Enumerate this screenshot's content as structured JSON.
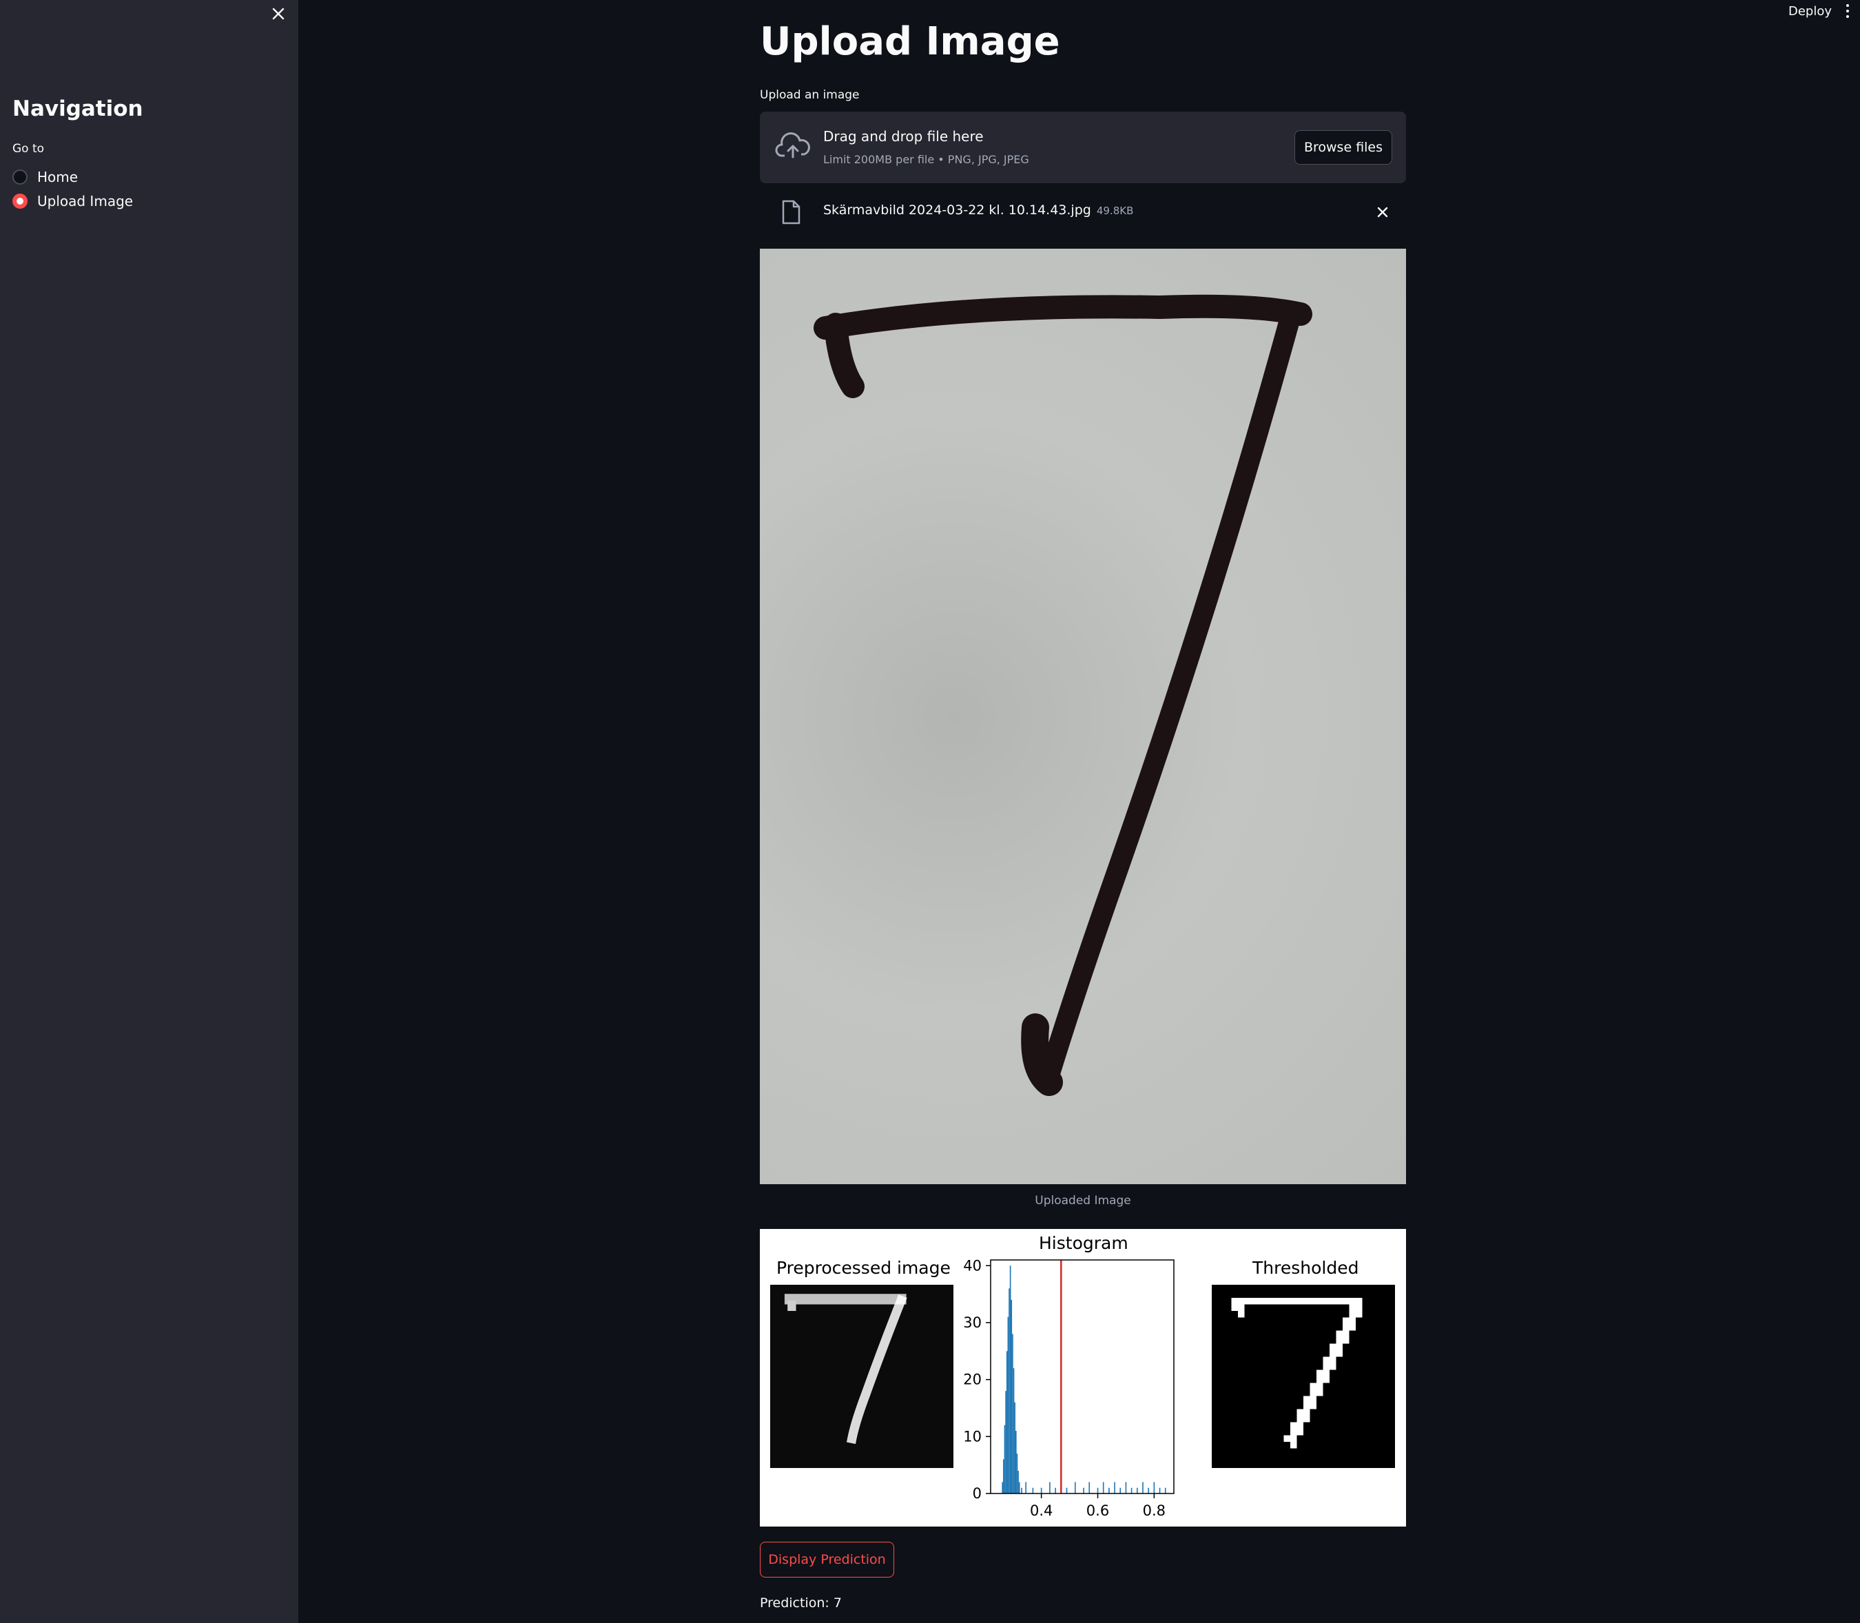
{
  "sidebar": {
    "title": "Navigation",
    "radio_label": "Go to",
    "options": [
      {
        "label": "Home",
        "selected": false
      },
      {
        "label": "Upload Image",
        "selected": true
      }
    ]
  },
  "header": {
    "deploy_label": "Deploy"
  },
  "main": {
    "title": "Upload Image",
    "uploader": {
      "label": "Upload an image",
      "drop_text": "Drag and drop file here",
      "limit_text": "Limit 200MB per file • PNG, JPG, JPEG",
      "browse_label": "Browse files"
    },
    "file": {
      "name": "Skärmavbild 2024-03-22 kl. 10.14.43.jpg",
      "size": "49.8KB"
    },
    "image_caption": "Uploaded Image",
    "figure": {
      "titles": {
        "preprocessed": "Preprocessed image",
        "histogram": "Histogram",
        "thresholded": "Thresholded"
      },
      "colors": {
        "bars": "#1f77b4",
        "threshold": "#d62728"
      }
    },
    "predict_button": "Display Prediction",
    "prediction_text": "Prediction: 7"
  },
  "chart_data": {
    "type": "bar",
    "title": "Histogram",
    "xlabel": "",
    "ylabel": "",
    "xlim": [
      0.22,
      0.87
    ],
    "ylim": [
      0,
      41
    ],
    "x_ticks": [
      0.4,
      0.6,
      0.8
    ],
    "y_ticks": [
      0,
      10,
      20,
      30,
      40
    ],
    "threshold_line_x": 0.47,
    "bins": [
      {
        "x": 0.262,
        "y": 2
      },
      {
        "x": 0.266,
        "y": 6
      },
      {
        "x": 0.27,
        "y": 12
      },
      {
        "x": 0.274,
        "y": 18
      },
      {
        "x": 0.278,
        "y": 25
      },
      {
        "x": 0.282,
        "y": 31
      },
      {
        "x": 0.286,
        "y": 36
      },
      {
        "x": 0.29,
        "y": 40
      },
      {
        "x": 0.294,
        "y": 34
      },
      {
        "x": 0.298,
        "y": 28
      },
      {
        "x": 0.302,
        "y": 22
      },
      {
        "x": 0.306,
        "y": 16
      },
      {
        "x": 0.31,
        "y": 11
      },
      {
        "x": 0.314,
        "y": 7
      },
      {
        "x": 0.318,
        "y": 4
      },
      {
        "x": 0.322,
        "y": 2
      },
      {
        "x": 0.33,
        "y": 1
      },
      {
        "x": 0.345,
        "y": 2
      },
      {
        "x": 0.37,
        "y": 1
      },
      {
        "x": 0.4,
        "y": 1
      },
      {
        "x": 0.43,
        "y": 2
      },
      {
        "x": 0.45,
        "y": 1
      },
      {
        "x": 0.49,
        "y": 1
      },
      {
        "x": 0.52,
        "y": 2
      },
      {
        "x": 0.55,
        "y": 1
      },
      {
        "x": 0.57,
        "y": 2
      },
      {
        "x": 0.6,
        "y": 1
      },
      {
        "x": 0.62,
        "y": 2
      },
      {
        "x": 0.64,
        "y": 1
      },
      {
        "x": 0.66,
        "y": 2
      },
      {
        "x": 0.68,
        "y": 1
      },
      {
        "x": 0.7,
        "y": 2
      },
      {
        "x": 0.72,
        "y": 1
      },
      {
        "x": 0.74,
        "y": 1
      },
      {
        "x": 0.76,
        "y": 2
      },
      {
        "x": 0.78,
        "y": 1
      },
      {
        "x": 0.8,
        "y": 2
      },
      {
        "x": 0.82,
        "y": 1
      },
      {
        "x": 0.84,
        "y": 1
      }
    ]
  }
}
